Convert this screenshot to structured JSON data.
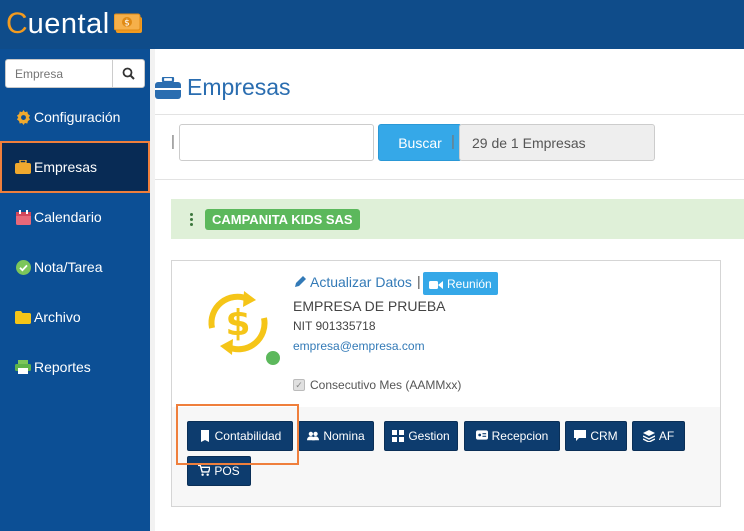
{
  "app": {
    "logo_first": "C",
    "logo_rest": "uental"
  },
  "sidebar": {
    "search_placeholder": "Empresa",
    "items": [
      {
        "label": "Configuración",
        "icon": "gear-icon"
      },
      {
        "label": "Empresas",
        "icon": "briefcase-icon"
      },
      {
        "label": "Calendario",
        "icon": "calendar-icon"
      },
      {
        "label": "Nota/Tarea",
        "icon": "check-circle-icon"
      },
      {
        "label": "Archivo",
        "icon": "folder-icon"
      },
      {
        "label": "Reportes",
        "icon": "printer-icon"
      }
    ],
    "active": "Empresas"
  },
  "main": {
    "title": "Empresas",
    "search_button": "Buscar",
    "count_text": "29 de 1 Empresas",
    "company_badge": "CAMPANITA KIDS SAS"
  },
  "card": {
    "update_link": "Actualizar Datos",
    "pipe": "|",
    "reunion_button": "Reunión",
    "company_name": "EMPRESA DE PRUEBA",
    "nit": "NIT 901335718",
    "email": "empresa@empresa.com",
    "consecutivo": "Consecutivo Mes (AAMMxx)",
    "modules": [
      "Contabilidad",
      "Nomina",
      "Gestion",
      "Recepcion",
      "CRM",
      "AF",
      "POS"
    ]
  },
  "colors": {
    "topbar": "#0f4c8a",
    "sidebar": "#0c4f95",
    "accent": "#35a8e8",
    "highlight": "#ef7f3c",
    "success": "#5cb85c"
  }
}
